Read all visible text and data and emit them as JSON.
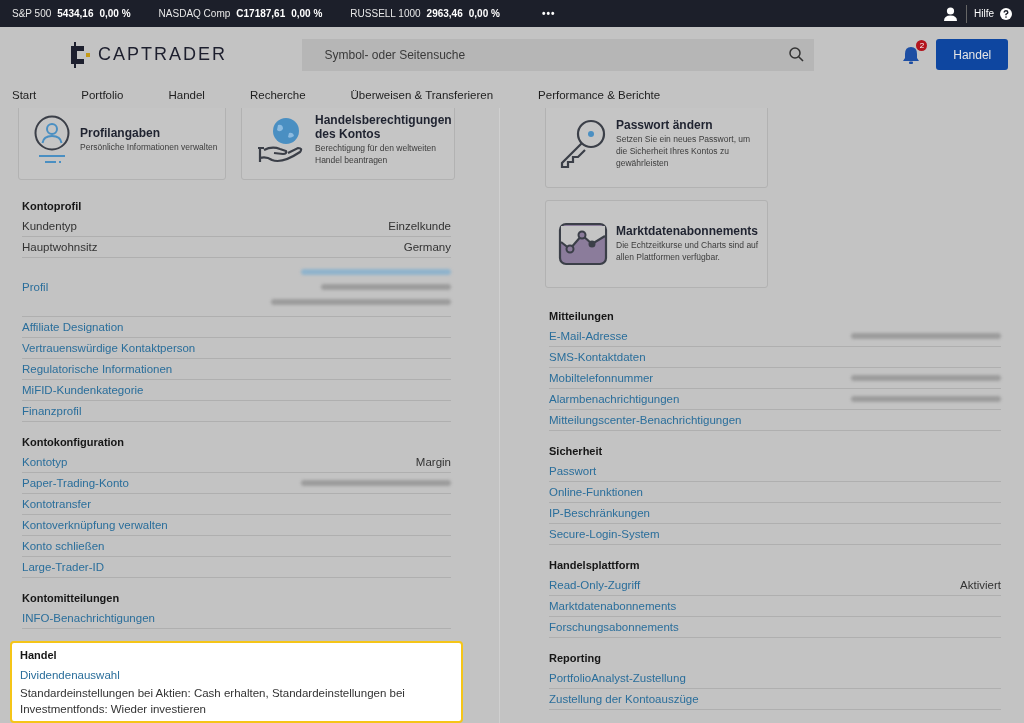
{
  "ticker": [
    {
      "name": "S&P 500",
      "value": "5434,16",
      "change": "0,00 %"
    },
    {
      "name": "NASDAQ Comp",
      "value": "C17187,61",
      "change": "0,00 %"
    },
    {
      "name": "RUSSELL 1000",
      "value": "2963,46",
      "change": "0,00 %"
    }
  ],
  "ticker_more": "•••",
  "help": "Hilfe",
  "logo": "CAPTRADER",
  "search": {
    "placeholder": "Symbol- oder Seitensuche"
  },
  "notifications": {
    "count": "2"
  },
  "trade_button": "Handel",
  "nav": [
    "Start",
    "Portfolio",
    "Handel",
    "Recherche",
    "Überweisen & Transferieren",
    "Performance & Berichte"
  ],
  "left": {
    "cards": [
      {
        "title": "Profilangaben",
        "description": "Persönliche Informationen verwalten"
      },
      {
        "title": "Handelsberechtigungen des Kontos",
        "description": "Berechtigung für den weltweiten Handel beantragen"
      }
    ],
    "sections": [
      {
        "title": "Kontoprofil",
        "highlighted": false,
        "rows": [
          {
            "kind": "text",
            "label": "Kundentyp",
            "value": "Einzelkunde"
          },
          {
            "kind": "text",
            "label": "Hauptwohnsitz",
            "value": "Germany"
          },
          {
            "kind": "link",
            "label": "Profil",
            "redacted": [
              {
                "kind": "link"
              },
              {
                "kind": "text"
              },
              {
                "kind": "text"
              }
            ]
          },
          {
            "kind": "link",
            "label": "Affiliate Designation"
          },
          {
            "kind": "link",
            "label": "Vertrauenswürdige Kontaktperson"
          },
          {
            "kind": "link",
            "label": "Regulatorische Informationen"
          },
          {
            "kind": "link",
            "label": "MiFID-Kundenkategorie"
          },
          {
            "kind": "link",
            "label": "Finanzprofil"
          }
        ]
      },
      {
        "title": "Kontokonfiguration",
        "highlighted": false,
        "rows": [
          {
            "kind": "link",
            "label": "Kontotyp",
            "value": "Margin"
          },
          {
            "kind": "link",
            "label": "Paper-Trading-Konto",
            "redacted": [
              {
                "kind": "text"
              }
            ]
          },
          {
            "kind": "link",
            "label": "Kontotransfer"
          },
          {
            "kind": "link",
            "label": "Kontoverknüpfung verwalten"
          },
          {
            "kind": "link",
            "label": "Konto schließen"
          },
          {
            "kind": "link",
            "label": "Large-Trader-ID"
          }
        ]
      },
      {
        "title": "Kontomitteilungen",
        "highlighted": false,
        "rows": [
          {
            "kind": "link",
            "label": "INFO-Benachrichtigungen"
          }
        ]
      },
      {
        "title": "Handel",
        "highlighted": true,
        "rows": [
          {
            "kind": "link",
            "label": "Dividendenauswahl",
            "detail": "Standardeinstellungen bei Aktien: Cash erhalten, Standardeinstellungen bei Investmentfonds: Wieder investieren"
          }
        ]
      }
    ]
  },
  "right": {
    "cards": [
      {
        "title": "Passwort ändern",
        "description": "Setzen Sie ein neues Passwort, um die Sicherheit Ihres Kontos zu gewährleisten"
      },
      {
        "title": "Marktdatenabonnements",
        "description": "Die Echtzeitkurse und Charts sind auf allen Plattformen verfügbar."
      }
    ],
    "sections": [
      {
        "title": "Mitteilungen",
        "highlighted": false,
        "rows": [
          {
            "kind": "link",
            "label": "E-Mail-Adresse",
            "redacted": [
              {
                "kind": "text"
              }
            ]
          },
          {
            "kind": "link",
            "label": "SMS-Kontaktdaten"
          },
          {
            "kind": "link",
            "label": "Mobiltelefonnummer",
            "redacted": [
              {
                "kind": "text"
              }
            ]
          },
          {
            "kind": "link",
            "label": "Alarmbenachrichtigungen",
            "redacted": [
              {
                "kind": "text"
              }
            ]
          },
          {
            "kind": "link",
            "label": "Mitteilungscenter-Benachrichtigungen"
          }
        ]
      },
      {
        "title": "Sicherheit",
        "highlighted": false,
        "rows": [
          {
            "kind": "link",
            "label": "Passwort"
          },
          {
            "kind": "link",
            "label": "Online-Funktionen"
          },
          {
            "kind": "link",
            "label": "IP-Beschränkungen"
          },
          {
            "kind": "link",
            "label": "Secure-Login-System"
          }
        ]
      },
      {
        "title": "Handelsplattform",
        "highlighted": false,
        "rows": [
          {
            "kind": "link",
            "label": "Read-Only-Zugriff",
            "value": "Aktiviert"
          },
          {
            "kind": "link",
            "label": "Marktdatenabonnements"
          },
          {
            "kind": "link",
            "label": "Forschungsabonnements"
          }
        ]
      },
      {
        "title": "Reporting",
        "highlighted": false,
        "rows": [
          {
            "kind": "link",
            "label": "PortfolioAnalyst-Zustellung"
          },
          {
            "kind": "link",
            "label": "Zustellung der Kontoauszüge"
          }
        ]
      }
    ]
  }
}
